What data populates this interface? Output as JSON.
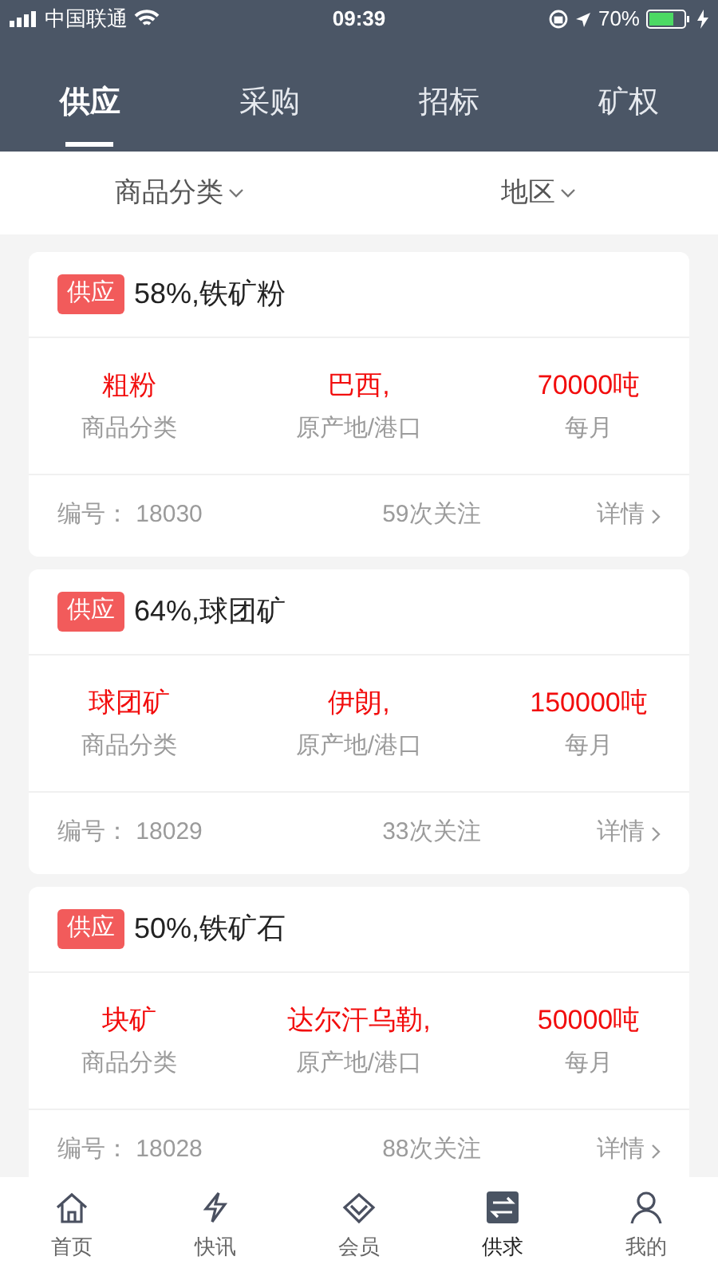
{
  "status_bar": {
    "carrier": "中国联通",
    "time": "09:39",
    "battery": "70%"
  },
  "tabs": [
    {
      "label": "供应",
      "selected": true
    },
    {
      "label": "采购",
      "selected": false
    },
    {
      "label": "招标",
      "selected": false
    },
    {
      "label": "矿权",
      "selected": false
    }
  ],
  "filters": [
    {
      "label": "商品分类"
    },
    {
      "label": "地区"
    }
  ],
  "listings": [
    {
      "badge": "供应",
      "title": "58%,铁矿粉",
      "fields": [
        {
          "value": "粗粉",
          "label": "商品分类"
        },
        {
          "value": "巴西,",
          "label": "原产地/港口"
        },
        {
          "value": "70000吨",
          "label": "每月"
        }
      ],
      "number": "编号： 18030",
      "follows": "59次关注",
      "details": "详情"
    },
    {
      "badge": "供应",
      "title": "64%,球团矿",
      "fields": [
        {
          "value": "球团矿",
          "label": "商品分类"
        },
        {
          "value": "伊朗,",
          "label": "原产地/港口"
        },
        {
          "value": "150000吨",
          "label": "每月"
        }
      ],
      "number": "编号： 18029",
      "follows": "33次关注",
      "details": "详情"
    },
    {
      "badge": "供应",
      "title": "50%,铁矿石",
      "fields": [
        {
          "value": "块矿",
          "label": "商品分类"
        },
        {
          "value": "达尔汗乌勒,",
          "label": "原产地/港口"
        },
        {
          "value": "50000吨",
          "label": "每月"
        }
      ],
      "number": "编号： 18028",
      "follows": "88次关注",
      "details": "详情"
    }
  ],
  "bottom_nav": [
    {
      "kind": "home",
      "label": "首页",
      "selected": false
    },
    {
      "kind": "bolt",
      "label": "快讯",
      "selected": false
    },
    {
      "kind": "diamond",
      "label": "会员",
      "selected": false
    },
    {
      "kind": "exchange",
      "label": "供求",
      "selected": true
    },
    {
      "kind": "user",
      "label": "我的",
      "selected": false
    }
  ]
}
